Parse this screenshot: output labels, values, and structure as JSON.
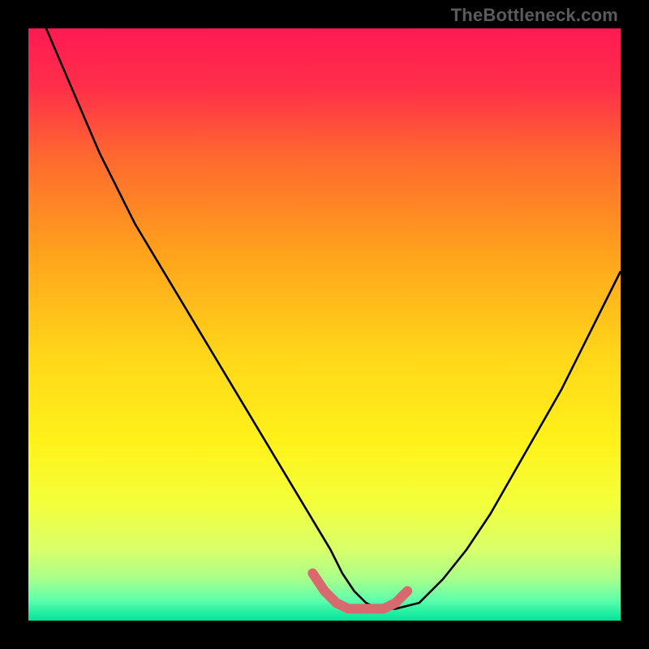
{
  "watermark": "TheBottleneck.com",
  "chart_data": {
    "type": "line",
    "title": "",
    "xlabel": "",
    "ylabel": "",
    "xlim": [
      0,
      100
    ],
    "ylim": [
      0,
      100
    ],
    "gradient_stops": [
      {
        "pct": 0.0,
        "color": "#ff1a52"
      },
      {
        "pct": 0.1,
        "color": "#ff2f4a"
      },
      {
        "pct": 0.22,
        "color": "#ff6a2f"
      },
      {
        "pct": 0.38,
        "color": "#ffa21c"
      },
      {
        "pct": 0.55,
        "color": "#ffd61a"
      },
      {
        "pct": 0.7,
        "color": "#fff21a"
      },
      {
        "pct": 0.8,
        "color": "#f3ff3a"
      },
      {
        "pct": 0.88,
        "color": "#d9ff6a"
      },
      {
        "pct": 0.93,
        "color": "#a8ff8c"
      },
      {
        "pct": 0.965,
        "color": "#5effac"
      },
      {
        "pct": 1.0,
        "color": "#00e49a"
      }
    ],
    "series": [
      {
        "name": "bottleneck-curve",
        "x": [
          0,
          3,
          6,
          9,
          12,
          15,
          18,
          21,
          24,
          27,
          30,
          33,
          36,
          39,
          42,
          45,
          48,
          51,
          53,
          55,
          57,
          59,
          62,
          66,
          70,
          74,
          78,
          82,
          86,
          90,
          94,
          98,
          100
        ],
        "values": [
          108,
          100,
          93,
          86,
          79,
          73,
          67,
          62,
          57,
          52,
          47,
          42,
          37,
          32,
          27,
          22,
          17,
          12,
          8,
          5,
          3,
          2,
          2,
          3,
          7,
          12,
          18,
          25,
          32,
          39,
          47,
          55,
          59
        ]
      }
    ],
    "highlight": {
      "name": "bottom-highlight",
      "color": "#d86a6f",
      "x": [
        48,
        50,
        52,
        54,
        56,
        58,
        60,
        62,
        64
      ],
      "values": [
        8,
        5,
        3,
        2,
        2,
        2,
        2,
        3,
        5
      ]
    }
  }
}
